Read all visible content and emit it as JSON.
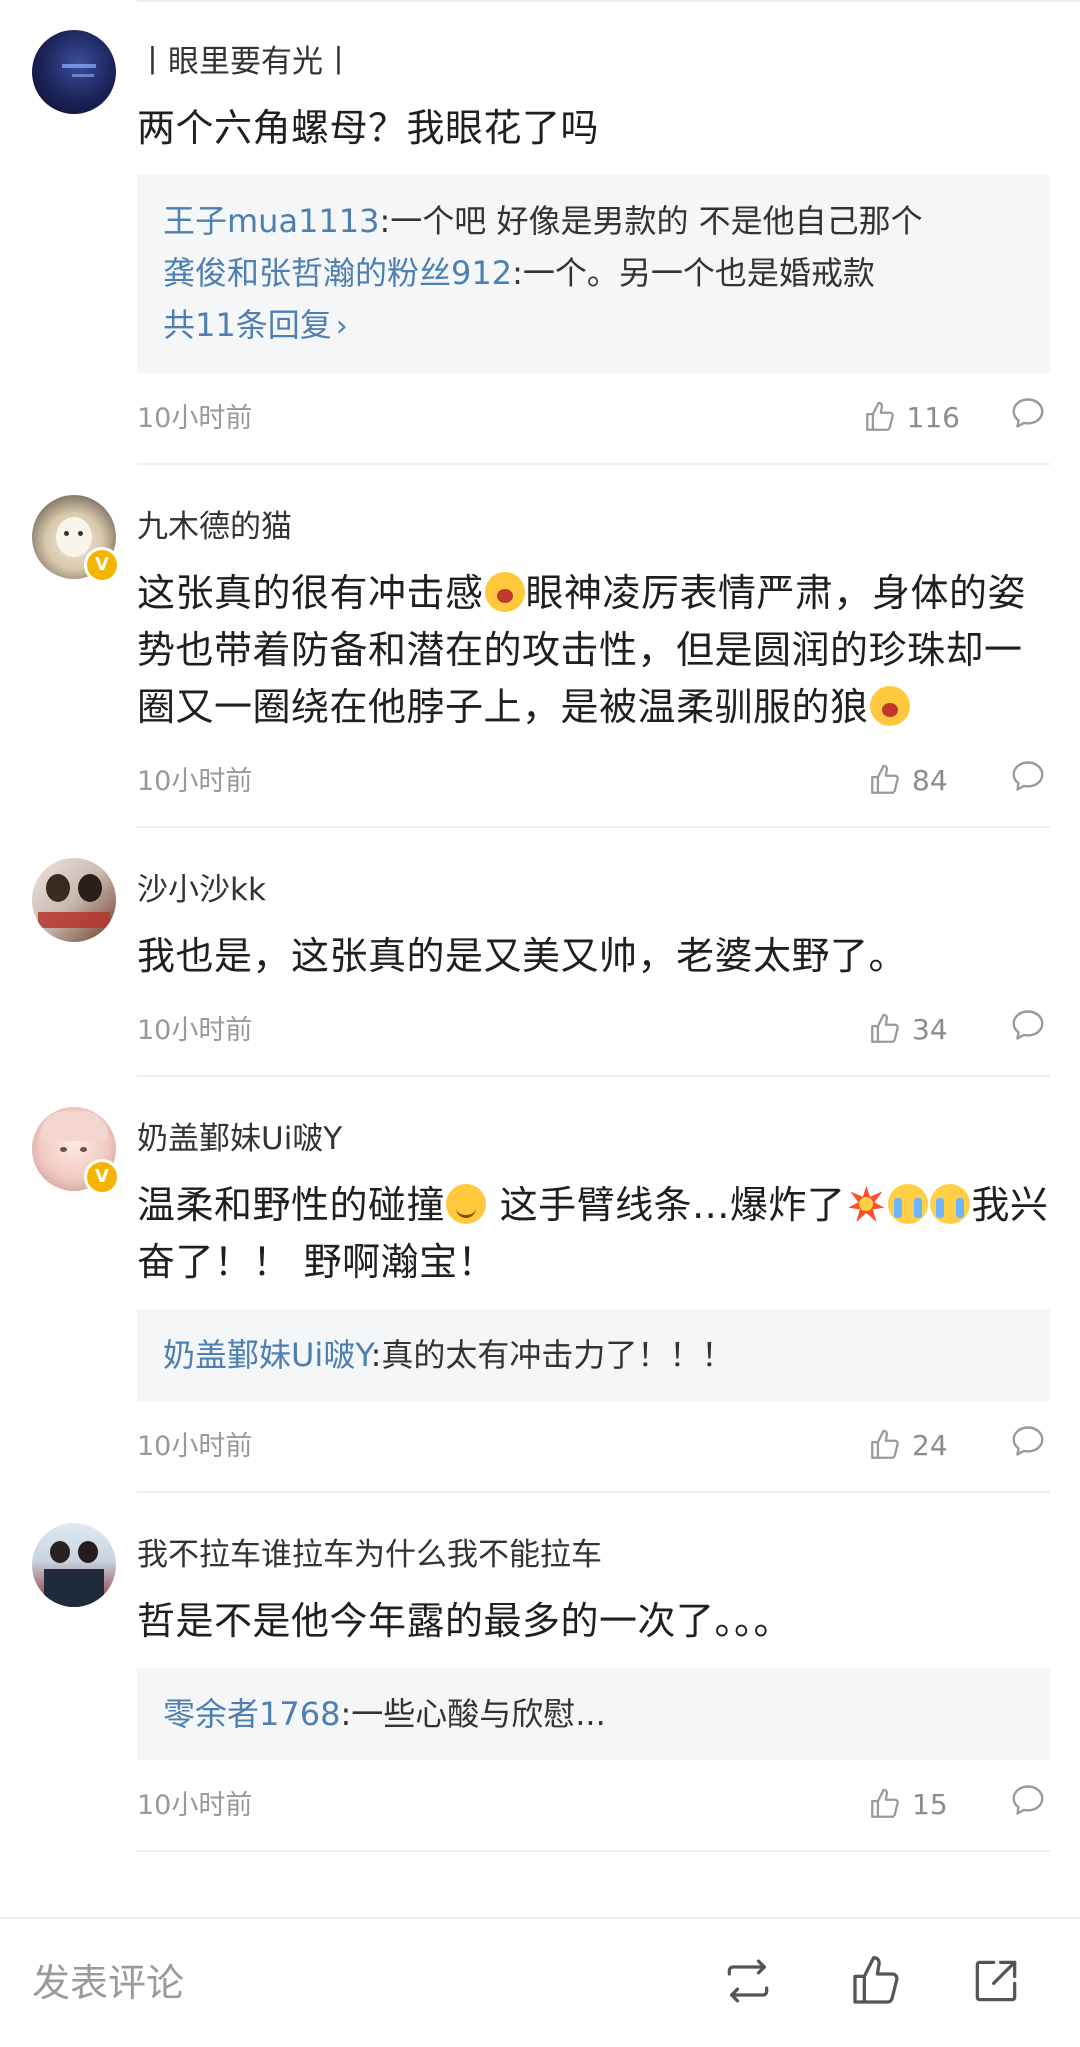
{
  "comments": [
    {
      "username": "丨眼里要有光丨",
      "verified": false,
      "avatar": "dark-blue-city-avatar",
      "content": "两个六角螺母？我眼花了吗",
      "replies": [
        {
          "name": "王子mua1113",
          "text": ":一个吧 好像是男款的 不是他自己那个"
        },
        {
          "name": "龚俊和张哲瀚的粉丝912",
          "text": ":一个。另一个也是婚戒款"
        }
      ],
      "more_replies": "共11条回复",
      "time": "10小时前",
      "likes": "116"
    },
    {
      "username": "九木德的猫",
      "verified": true,
      "avatar": "white-cat-avatar",
      "content_parts": [
        "这张真的很有冲击感",
        "眼神凌厉表情严肃，身体的姿势也带着防备和潜在的攻击性，但是圆润的珍珠却一圈又一圈绕在他脖子上，是被温柔驯服的狼"
      ],
      "emoji": "scream-emoji",
      "time": "10小时前",
      "likes": "84"
    },
    {
      "username": "沙小沙kk",
      "verified": false,
      "avatar": "couple-poster-avatar",
      "content": "我也是，这张真的是又美又帅，老婆太野了。",
      "time": "10小时前",
      "likes": "34"
    },
    {
      "username": "奶盖鄞妹Ui啵Y",
      "verified": true,
      "avatar": "anime-girl-avatar",
      "content_parts": [
        "温柔和野性的碰撞",
        " 这手臂线条...爆炸了",
        "我兴奋了！！ 野啊瀚宝！"
      ],
      "replies": [
        {
          "name": "奶盖鄞妹Ui啵Y",
          "text": ":真的太有冲击力了！！！"
        }
      ],
      "time": "10小时前",
      "likes": "24"
    },
    {
      "username": "我不拉车谁拉车为什么我不能拉车",
      "verified": false,
      "avatar": "two-people-avatar",
      "content": "哲是不是他今年露的最多的一次了。。。",
      "replies": [
        {
          "name": "零余者1768",
          "text": ":一些心酸与欣慰..."
        }
      ],
      "time": "10小时前",
      "likes": "15"
    }
  ],
  "bottom_bar": {
    "placeholder": "发表评论",
    "icons": [
      "repost-icon",
      "like-icon",
      "share-icon"
    ]
  },
  "colors": {
    "link": "#4d7fb0",
    "reply_bg": "#f5f6f8",
    "verified": "#f4b400"
  }
}
